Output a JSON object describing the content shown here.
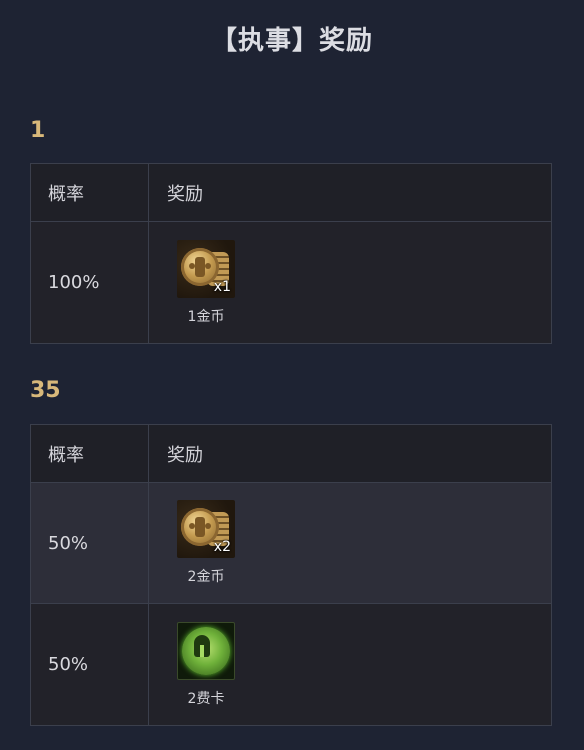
{
  "page": {
    "title": "【执事】奖励"
  },
  "sections": [
    {
      "heading": "1",
      "columns": [
        "概率",
        "奖励"
      ],
      "rows": [
        {
          "probability": "100%",
          "reward": {
            "icon": "gold-coin-icon",
            "quantity": "x1",
            "label": "1金币"
          }
        }
      ]
    },
    {
      "heading": "35",
      "columns": [
        "概率",
        "奖励"
      ],
      "rows": [
        {
          "probability": "50%",
          "reward": {
            "icon": "gold-coin-icon",
            "quantity": "x2",
            "label": "2金币"
          }
        },
        {
          "probability": "50%",
          "reward": {
            "icon": "green-helmet-card-icon",
            "quantity": "",
            "label": "2费卡"
          }
        }
      ]
    }
  ],
  "colors": {
    "background": "#1e2333",
    "heading": "#d8b87a",
    "border": "#3b3f4c"
  }
}
